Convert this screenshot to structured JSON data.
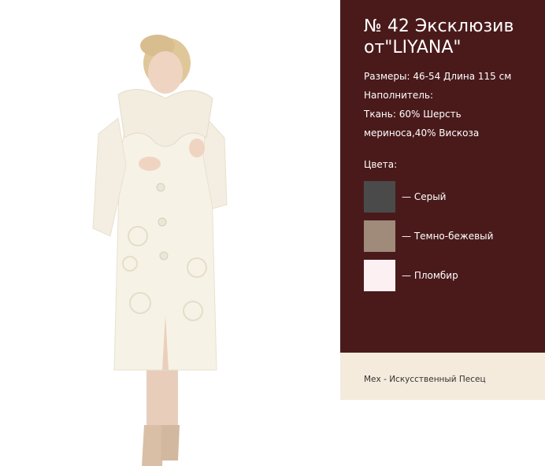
{
  "product": {
    "title": "№ 42 Эксклюзив от\"LIYANA\"",
    "specs": [
      "Размеры: 46-54 Длина 115 см",
      "Наполнитель:",
      "Ткань: 60% Шерсть",
      "мериноса,40% Вискоза"
    ],
    "colors_label": "Цвета:",
    "colors": [
      {
        "label": "— Серый",
        "hex": "#4a4a4a"
      },
      {
        "label": "— Темно-бежевый",
        "hex": "#a08a7a"
      },
      {
        "label": "— Пломбир",
        "hex": "#fdf0f3"
      }
    ],
    "footer_note": "Мех - Искусственный Песец"
  },
  "photo": {
    "icon": "model-in-white-coat-photo",
    "colors": {
      "coat": "#f6f2e6",
      "fur": "#f3ede0",
      "hair": "#e0c79a",
      "skin": "#f0d4c2",
      "boots": "#d9bfa6"
    }
  },
  "theme": {
    "panel_bg": "#4a1a1b",
    "footer_bg": "#f4ebdc"
  }
}
